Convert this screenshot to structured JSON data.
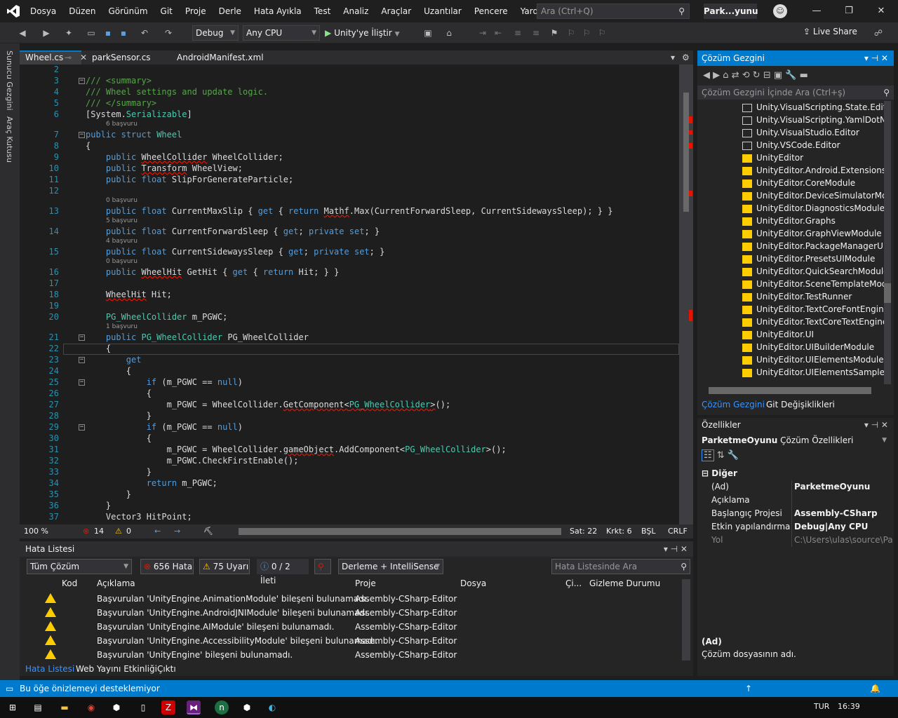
{
  "menubar": {
    "items": [
      "Dosya",
      "Düzen",
      "Görünüm",
      "Git",
      "Proje",
      "Derle",
      "Hata Ayıkla",
      "Test",
      "Analiz",
      "Araçlar",
      "Uzantılar",
      "Pencere",
      "Yardım"
    ],
    "search_placeholder": "Ara (Ctrl+Q)",
    "project_name": "Park...yunu",
    "window_controls": [
      "minimize-icon",
      "restore-icon",
      "close-icon"
    ]
  },
  "toolbar": {
    "config": "Debug",
    "platform": "Any CPU",
    "run_label": "Unity'ye İliştir",
    "liveshare_label": "Live Share"
  },
  "left_strip": {
    "tabs": [
      "Sunucu Gezgini",
      "Araç Kutusu"
    ]
  },
  "editor": {
    "tabs": [
      {
        "label": "Wheel.cs",
        "active": true
      },
      {
        "label": "parkSensor.cs",
        "active": false
      },
      {
        "label": "AndroidManifest.xml",
        "active": false
      }
    ],
    "lines": [
      {
        "n": "2",
        "html": ""
      },
      {
        "n": "3",
        "html": "<span class='cm'>/// &lt;summary&gt;</span>"
      },
      {
        "n": "4",
        "html": "<span class='cm'>/// Wheel settings and update logic.</span>"
      },
      {
        "n": "5",
        "html": "<span class='cm'>/// &lt;/summary&gt;</span>"
      },
      {
        "n": "6",
        "html": "[System.<span class='ty'>Serializable</span>]"
      },
      {
        "n": "7",
        "html": "<span class='kw'>public</span> <span class='kw'>struct</span> <span class='ty'>Wheel</span>"
      },
      {
        "n": "8",
        "html": "{"
      },
      {
        "n": "9",
        "html": "    <span class='kw'>public</span> <span class='sq'>WheelCollider</span> WheelCollider;"
      },
      {
        "n": "10",
        "html": "    <span class='kw'>public</span> <span class='sq'>Transform</span> WheelView;"
      },
      {
        "n": "11",
        "html": "    <span class='kw'>public</span> <span class='kw'>float</span> SlipForGenerateParticle;"
      },
      {
        "n": "12",
        "html": ""
      },
      {
        "n": "13",
        "html": "    <span class='kw'>public</span> <span class='kw'>float</span> CurrentMaxSlip { <span class='kw'>get</span> { <span class='kw'>return</span> <span class='sq'>Mathf</span>.Max(CurrentForwardSleep, CurrentSidewaysSleep); } }"
      },
      {
        "n": "14",
        "html": "    <span class='kw'>public</span> <span class='kw'>float</span> CurrentForwardSleep { <span class='kw'>get</span>; <span class='kw'>private</span> <span class='kw'>set</span>; }"
      },
      {
        "n": "15",
        "html": "    <span class='kw'>public</span> <span class='kw'>float</span> CurrentSidewaysSleep { <span class='kw'>get</span>; <span class='kw'>private</span> <span class='kw'>set</span>; }"
      },
      {
        "n": "16",
        "html": "    <span class='kw'>public</span> <span class='sq'>WheelHit</span> GetHit { <span class='kw'>get</span> { <span class='kw'>return</span> Hit; } }"
      },
      {
        "n": "17",
        "html": ""
      },
      {
        "n": "18",
        "html": "    <span class='sq'>WheelHit</span> Hit;"
      },
      {
        "n": "19",
        "html": ""
      },
      {
        "n": "20",
        "html": "    <span class='ty'>PG_WheelCollider</span> m_PGWC;"
      },
      {
        "n": "21",
        "html": "    <span class='kw'>public</span> <span class='ty'>PG_WheelCollider</span> PG_WheelCollider"
      },
      {
        "n": "22",
        "html": "    {"
      },
      {
        "n": "23",
        "html": "        <span class='kw'>get</span>"
      },
      {
        "n": "24",
        "html": "        {"
      },
      {
        "n": "25",
        "html": "            <span class='kw'>if</span> (m_PGWC == <span class='kw'>null</span>)"
      },
      {
        "n": "26",
        "html": "            {"
      },
      {
        "n": "27",
        "html": "                m_PGWC = WheelCollider.<span class='sq'>GetComponent&lt;<span class='ty'>PG_WheelCollider</span>&gt;</span>();"
      },
      {
        "n": "28",
        "html": "            }"
      },
      {
        "n": "29",
        "html": "            <span class='kw'>if</span> (m_PGWC == <span class='kw'>null</span>)"
      },
      {
        "n": "30",
        "html": "            {"
      },
      {
        "n": "31",
        "html": "                m_PGWC = WheelCollider.<span class='sq'>gameObject</span>.AddComponent&lt;<span class='ty'>PG_WheelCollider</span>&gt;();"
      },
      {
        "n": "32",
        "html": "                m_PGWC.CheckFirstEnable();"
      },
      {
        "n": "33",
        "html": "            }"
      },
      {
        "n": "34",
        "html": "            <span class='kw'>return</span> m_PGWC;"
      },
      {
        "n": "35",
        "html": "        }"
      },
      {
        "n": "36",
        "html": "    }"
      },
      {
        "n": "37",
        "html": "    Vector3 HitPoint;"
      }
    ],
    "lens": [
      {
        "after": "6",
        "text": "6 başvuru"
      },
      {
        "after": "12",
        "text": "0 başvuru"
      },
      {
        "after": "13",
        "text": "5 başvuru"
      },
      {
        "after": "14",
        "text": "4 başvuru"
      },
      {
        "after": "15",
        "text": "0 başvuru"
      },
      {
        "after": "20",
        "text": "1 başvuru"
      }
    ],
    "status": {
      "zoom": "100 %",
      "errors": "14",
      "warnings": "0",
      "line": "Sat: 22",
      "col": "Krkt: 6",
      "mode": "BŞL",
      "eol": "CRLF"
    }
  },
  "error_list": {
    "title": "Hata Listesi",
    "scope": "Tüm Çözüm",
    "errors_btn": "656 Hata",
    "warnings_btn": "75 Uyarı",
    "messages_btn": "0 / 2 İleti",
    "build_filter": "Derleme + IntelliSense",
    "search_placeholder": "Hata Listesinde Ara",
    "columns": [
      "Kod",
      "Açıklama",
      "Proje",
      "Dosya",
      "Çi...",
      "Gizleme Durumu"
    ],
    "rows": [
      {
        "desc": "Başvurulan 'UnityEngine.AnimationModule' bileşeni bulunamadı.",
        "project": "Assembly-CSharp-Editor"
      },
      {
        "desc": "Başvurulan 'UnityEngine.AndroidJNIModule' bileşeni bulunamadı.",
        "project": "Assembly-CSharp-Editor"
      },
      {
        "desc": "Başvurulan 'UnityEngine.AIModule' bileşeni bulunamadı.",
        "project": "Assembly-CSharp-Editor"
      },
      {
        "desc": "Başvurulan 'UnityEngine.AccessibilityModule' bileşeni bulunamadı.",
        "project": "Assembly-CSharp-Editor"
      },
      {
        "desc": "Başvurulan 'UnityEngine' bileşeni bulunamadı.",
        "project": "Assembly-CSharp-Editor"
      }
    ],
    "bottom_tabs": [
      "Hata Listesi",
      "Web Yayını Etkinliği",
      "Çıktı"
    ]
  },
  "solution": {
    "title": "Çözüm Gezgini",
    "search_placeholder": "Çözüm Gezgini İçinde Ara (Ctrl+ş)",
    "items": [
      {
        "label": "Unity.VisualScripting.State.Editor",
        "warn": false
      },
      {
        "label": "Unity.VisualScripting.YamlDotNet",
        "warn": false
      },
      {
        "label": "Unity.VisualStudio.Editor",
        "warn": false
      },
      {
        "label": "Unity.VSCode.Editor",
        "warn": false
      },
      {
        "label": "UnityEditor",
        "warn": true
      },
      {
        "label": "UnityEditor.Android.Extensions",
        "warn": true
      },
      {
        "label": "UnityEditor.CoreModule",
        "warn": true
      },
      {
        "label": "UnityEditor.DeviceSimulatorModule",
        "warn": true
      },
      {
        "label": "UnityEditor.DiagnosticsModule",
        "warn": true
      },
      {
        "label": "UnityEditor.Graphs",
        "warn": true
      },
      {
        "label": "UnityEditor.GraphViewModule",
        "warn": true
      },
      {
        "label": "UnityEditor.PackageManagerUIModule",
        "warn": true
      },
      {
        "label": "UnityEditor.PresetsUIModule",
        "warn": true
      },
      {
        "label": "UnityEditor.QuickSearchModule",
        "warn": true
      },
      {
        "label": "UnityEditor.SceneTemplateModule",
        "warn": true
      },
      {
        "label": "UnityEditor.TestRunner",
        "warn": true
      },
      {
        "label": "UnityEditor.TextCoreFontEngineModule",
        "warn": true
      },
      {
        "label": "UnityEditor.TextCoreTextEngineModule",
        "warn": true
      },
      {
        "label": "UnityEditor.UI",
        "warn": true
      },
      {
        "label": "UnityEditor.UIBuilderModule",
        "warn": true
      },
      {
        "label": "UnityEditor.UIElementsModule",
        "warn": true
      },
      {
        "label": "UnityEditor.UIElementsSamplesModule",
        "warn": true
      }
    ],
    "bottom_tabs": [
      "Çözüm Gezgini",
      "Git Değişiklikleri"
    ]
  },
  "properties": {
    "title": "Özellikler",
    "object": "ParketmeOyunu",
    "object_type": "Çözüm Özellikleri",
    "category": "Diğer",
    "rows": [
      {
        "name": "(Ad)",
        "value": "ParketmeOyunu"
      },
      {
        "name": "Açıklama",
        "value": ""
      },
      {
        "name": "Başlangıç Projesi",
        "value": "Assembly-CSharp"
      },
      {
        "name": "Etkin yapılandırma",
        "value": "Debug|Any CPU"
      },
      {
        "name": "Yol",
        "value": "C:\\Users\\ulas\\source\\ParketmeOyunu"
      }
    ],
    "desc_title": "(Ad)",
    "desc_text": "Çözüm dosyasının adı."
  },
  "statusbar": {
    "message": "Bu öğe önizlemeyi desteklemiyor"
  },
  "taskbar": {
    "lang": "TUR",
    "time": "16:39"
  },
  "colors": {
    "accent": "#007acc",
    "keyword": "#569cd6",
    "type": "#4ec9b0",
    "comment": "#57a64a"
  }
}
